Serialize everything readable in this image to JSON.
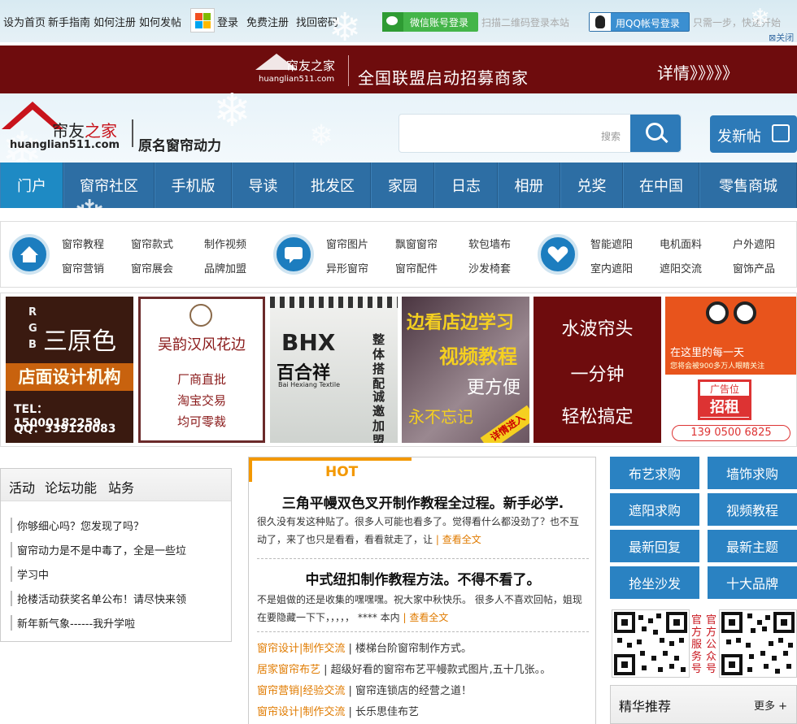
{
  "topbar": {
    "links": [
      "设为首页",
      "新手指南",
      "如何注册",
      "如何发帖"
    ],
    "login": "登录",
    "register": "免费注册",
    "find_password": "找回密码",
    "wechat_login": "微信账号登录",
    "wechat_hint": "扫描二维码登录本站",
    "qq_login": "用QQ帐号登录",
    "qq_hint": "只需一步，快速开始",
    "close": "关闭"
  },
  "banner": {
    "logo_name": "帘友之家",
    "logo_domain": "huanglian511.com",
    "slogan": "全国联盟启动招募商家",
    "more": "详情》》》》》"
  },
  "header": {
    "logo_name_a": "帘友",
    "logo_name_b": "之家",
    "logo_domain": "huanglian511.com",
    "slogan": "原名窗帘动力",
    "search_placeholder": "搜索",
    "post_button": "发新帖"
  },
  "nav": [
    "门户",
    "窗帘社区",
    "手机版",
    "导读",
    "批发区",
    "家园",
    "日志",
    "相册",
    "兑奖",
    "在中国",
    "零售商城"
  ],
  "subnav": {
    "group1": [
      [
        "窗帘教程",
        "窗帘款式",
        "制作视频"
      ],
      [
        "窗帘营销",
        "窗帘展会",
        "品牌加盟"
      ]
    ],
    "group2": [
      [
        "窗帘图片",
        "飘窗窗帘",
        "软包墙布"
      ],
      [
        "异形窗帘",
        "窗帘配件",
        "沙发椅套"
      ]
    ],
    "group3": [
      [
        "智能遮阳",
        "电机面料",
        "户外遮阳"
      ],
      [
        "室内遮阳",
        "遮阳交流",
        "窗饰产品"
      ]
    ]
  },
  "ads": {
    "ad1": {
      "letters": "R G B",
      "brand": "三原色",
      "line": "店面设计机构",
      "tel": "TEL：15000182259",
      "qq": "QQ：339120083"
    },
    "ad2": {
      "title": "吴韵汉风花边",
      "l1": "厂商直批",
      "l2": "淘宝交易",
      "l3": "均可零裁"
    },
    "ad3": {
      "logo": "BHX",
      "name": "百合祥",
      "en": "Bai Hexiang Textile",
      "side1": "整体搭配",
      "side2": "诚邀加盟"
    },
    "ad4": {
      "l1": "边看店边学习",
      "l2": "视频教程",
      "l3": "更方便",
      "l4": "永不忘记",
      "tag": "详情进入"
    },
    "ad5": {
      "l1": "水波帘头",
      "l2": "一分钟",
      "l3": "轻松搞定"
    },
    "ad6": {
      "l1": "在这里的每一天",
      "l2": "您将会被900多万人眼睛关注",
      "l3": "广告位",
      "l4": "招租",
      "tel": "139 0500 6825"
    }
  },
  "left_panel": {
    "tabs": [
      "活动",
      "论坛功能",
      "站务"
    ],
    "items": [
      "你够细心吗？您发现了吗？",
      "窗帘动力是不是中毒了，全是一些垃",
      "学习中",
      "抢楼活动获奖名单公布！请尽快来领",
      "新年新气象------我升学啦"
    ]
  },
  "hot": {
    "label": "HOT",
    "articles": [
      {
        "title": "三角平幔双色叉开制作教程全过程。新手必学.",
        "line1": "很久没有发这种贴了。很多人可能也看多了。觉得看什么都没劲了？也不互",
        "line2": "动了，来了也只是看看，看看就走了，让",
        "more": "| 查看全文"
      },
      {
        "title": "中式纽扣制作教程方法。不得不看了。",
        "line1": "不是姐做的还是收集的嘿嘿嘿。祝大家中秋快乐。 很多人不喜欢回帖，姐现",
        "line2": "在要隐藏一下下，，，，， **** 本内",
        "more": "| 查看全文"
      }
    ],
    "list": [
      {
        "cat": "窗帘设计|制作交流",
        "title": "| 楼梯台阶窗帘制作方式。"
      },
      {
        "cat": "居家窗帘布艺",
        "title": "| 超级好看的窗帘布艺平幔款式图片,五十几张。。"
      },
      {
        "cat": "窗帘营销|经验交流",
        "title": "| 窗帘连锁店的经营之道！"
      },
      {
        "cat": "窗帘设计|制作交流",
        "title": "| 长乐思佳布艺"
      }
    ]
  },
  "right_panel": {
    "buttons": [
      "布艺求购",
      "墙饰求购",
      "遮阳求购",
      "视频教程",
      "最新回复",
      "最新主题",
      "抢坐沙发",
      "十大品牌"
    ],
    "qr1_label": "官方服务号",
    "qr2_label": "官方公众号",
    "featured": "精华推荐",
    "more": "更多 +"
  },
  "colors": {
    "nav": "#2d6ea4",
    "nav_active": "#1e8ac4",
    "banner": "#6e0c0d",
    "hot": "#f39800",
    "button": "#2a82c2"
  }
}
